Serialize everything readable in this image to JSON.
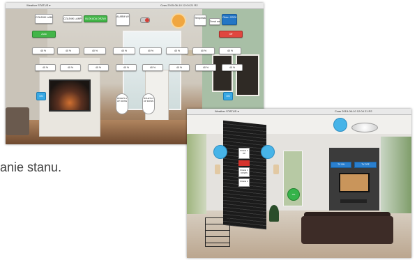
{
  "caption": "anie stanu.",
  "screen1": {
    "titlebar": {
      "left": "Weather  STATUS ▾",
      "center": "Czas  2015-06-10 12:04 21 R2"
    },
    "top_buttons": [
      "CZUJNIK LAMPY salon",
      "CZUJNIK LAMPY",
      "BLOKADA DRZWI",
      "ALARM WYLACZ CZUJKI",
      "Temperatura salon 22C",
      "Drzwi wejsciowe"
    ],
    "status_buttons": {
      "green": "Auto",
      "red": "Off",
      "blue_right": "Obec. OSOBA"
    },
    "row1": [
      "40 %",
      "40 %",
      "40 %",
      "40 %",
      "40 %",
      "40 %",
      "40 %",
      "40 %"
    ],
    "row2": [
      "40 %",
      "40 %",
      "40 %",
      "40 %",
      "40 %",
      "40 %",
      "40 %",
      "40 %"
    ],
    "bubbles": [
      "ROLETA 1 UP DOWN",
      "ROLETA 2 UP DOWN"
    ],
    "small_blue": [
      "ON",
      "ON"
    ]
  },
  "screen2": {
    "titlebar": {
      "left": "Weather  STATUS ▾",
      "center": "Czas  2015-06-10 12:04 21 R2"
    },
    "panel_buttons": [
      "Roleta 1 UP",
      "Roleta 1 DOWN",
      "Roleta 2"
    ],
    "tv_buttons": [
      "TV ON",
      "TV OFF"
    ],
    "green_label": "ON"
  },
  "colors": {
    "green": "#42b548",
    "red": "#e0463f",
    "blue": "#2476c5",
    "light_blue": "#47b4e8",
    "orange": "#f0a640"
  }
}
